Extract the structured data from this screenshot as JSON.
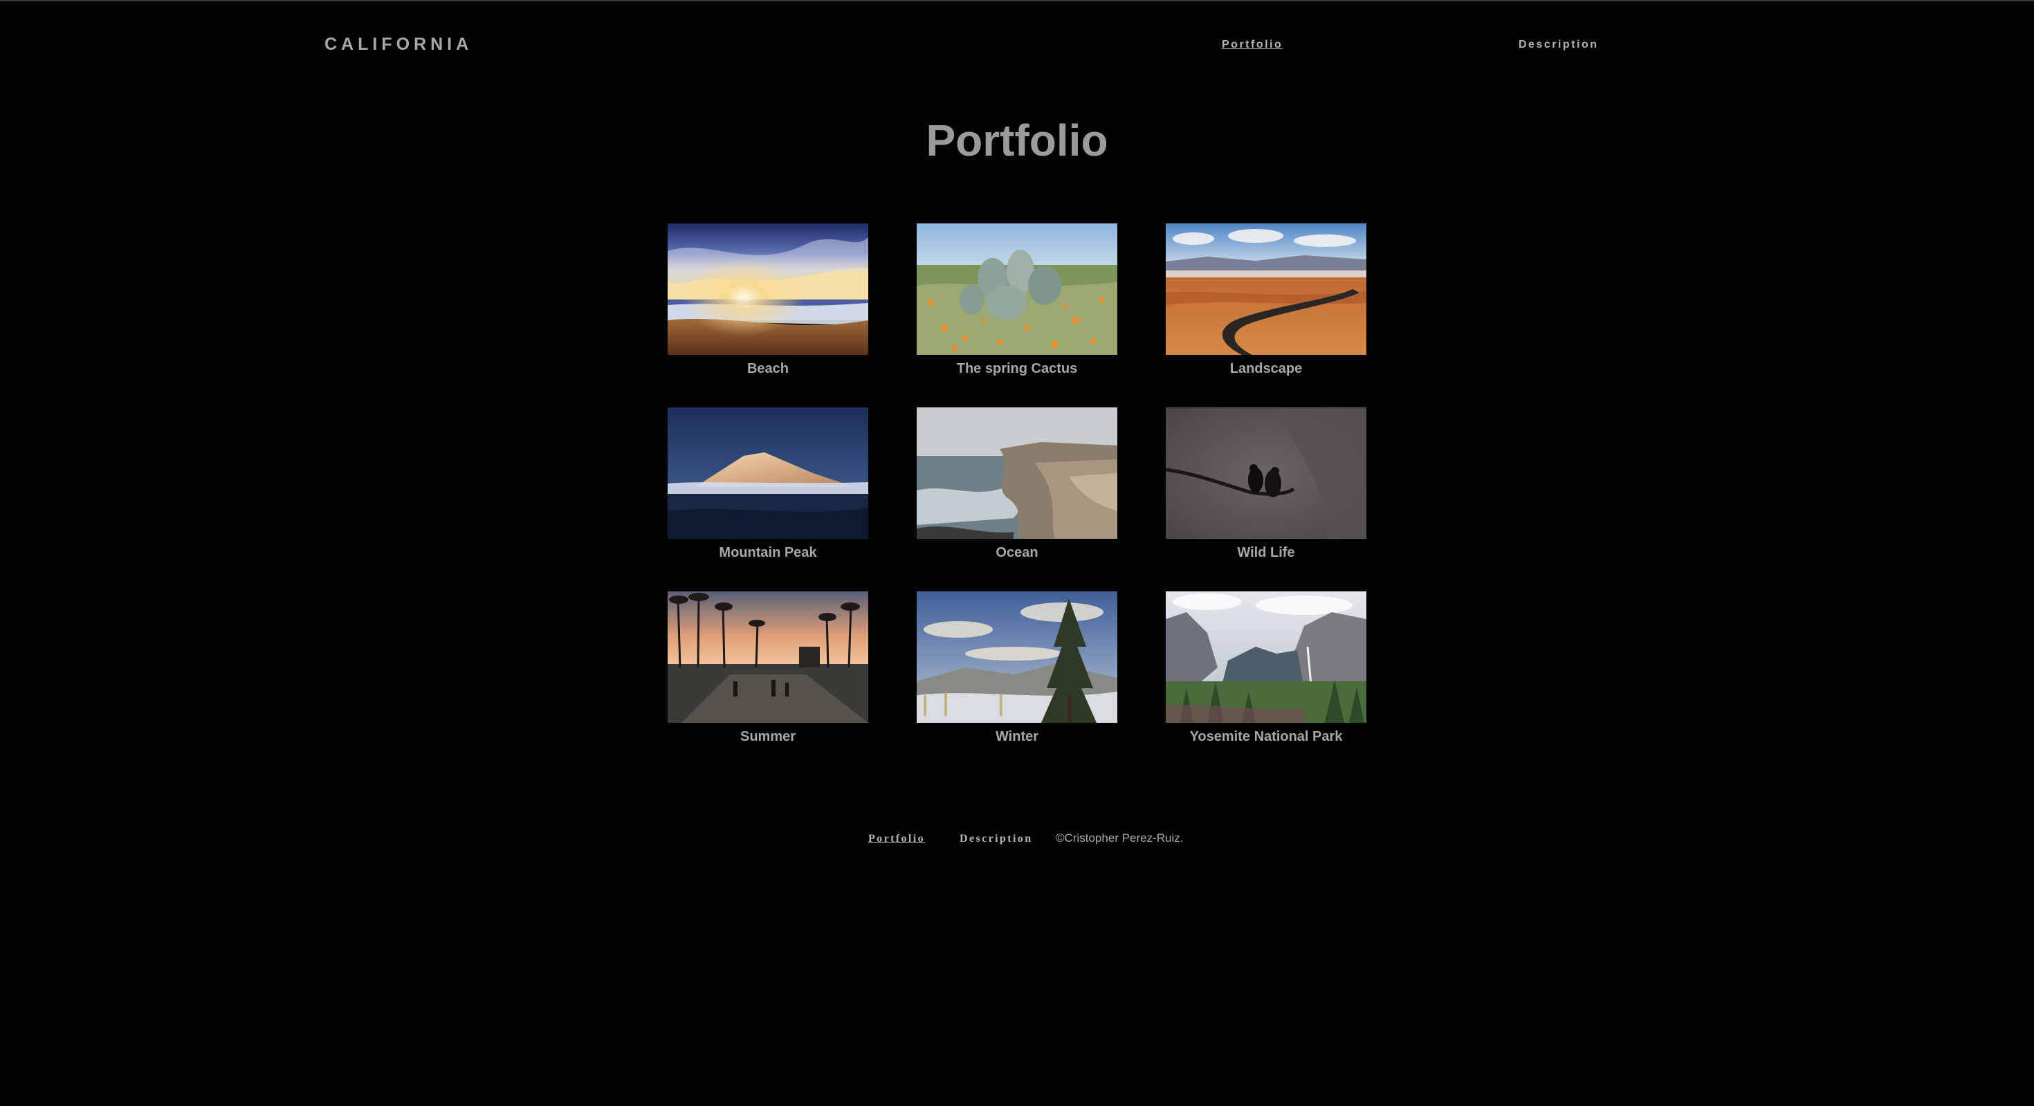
{
  "header": {
    "brand": "CALIFORNIA",
    "nav": [
      {
        "label": "Portfolio",
        "active": true
      },
      {
        "label": "Description",
        "active": false
      }
    ]
  },
  "main": {
    "title": "Portfolio",
    "gallery": [
      {
        "caption": "Beach"
      },
      {
        "caption": "The spring Cactus"
      },
      {
        "caption": "Landscape"
      },
      {
        "caption": "Mountain Peak"
      },
      {
        "caption": "Ocean"
      },
      {
        "caption": "Wild Life"
      },
      {
        "caption": "Summer"
      },
      {
        "caption": "Winter"
      },
      {
        "caption": "Yosemite National Park"
      }
    ]
  },
  "footer": {
    "links": [
      {
        "label": "Portfolio",
        "active": true
      },
      {
        "label": "Description",
        "active": false
      }
    ],
    "copyright": "©Cristopher Perez-Ruiz."
  },
  "colors": {
    "background": "#030303",
    "text": "#a8a8a8",
    "title": "#9b9b9b"
  }
}
